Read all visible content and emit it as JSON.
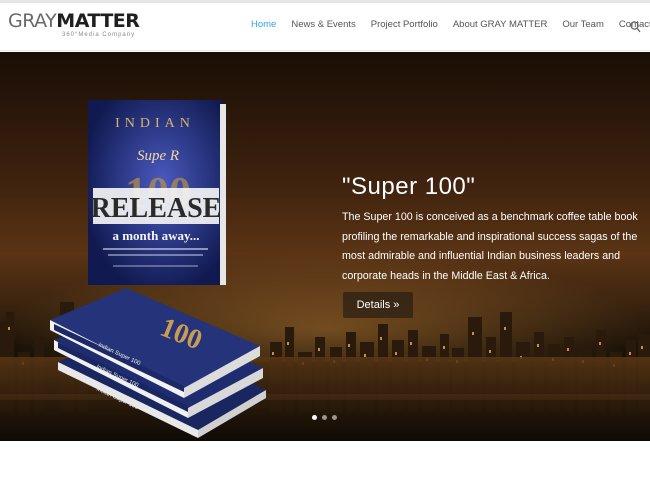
{
  "logo": {
    "part1": "GRAY",
    "part2": "MATTER",
    "tagline": "360°Media Company"
  },
  "nav": {
    "items": [
      {
        "label": "Home",
        "active": true
      },
      {
        "label": "News & Events",
        "active": false
      },
      {
        "label": "Project Portfolio",
        "active": false
      },
      {
        "label": "About GRAY MATTER",
        "active": false
      },
      {
        "label": "Our Team",
        "active": false
      },
      {
        "label": "Contact",
        "active": false
      }
    ],
    "search_icon": "search-icon"
  },
  "book": {
    "top": "INDIAN",
    "brand": "Supe R",
    "release": "RELEASE",
    "subtitle": "a month away...",
    "big_number": "100",
    "spine": "Indian Super 100"
  },
  "slide": {
    "title": "\"Super 100\"",
    "text": "The Super 100 is conceived as a benchmark coffee table book profiling the remarkable and inspirational success sagas of the most admirable and influential Indian business leaders and corporate heads in the Middle East & Africa.",
    "button": "Details »"
  },
  "slider": {
    "count": 3,
    "active_index": 0
  },
  "colors": {
    "accent": "#2ea3f2",
    "nav_text": "#555555"
  }
}
